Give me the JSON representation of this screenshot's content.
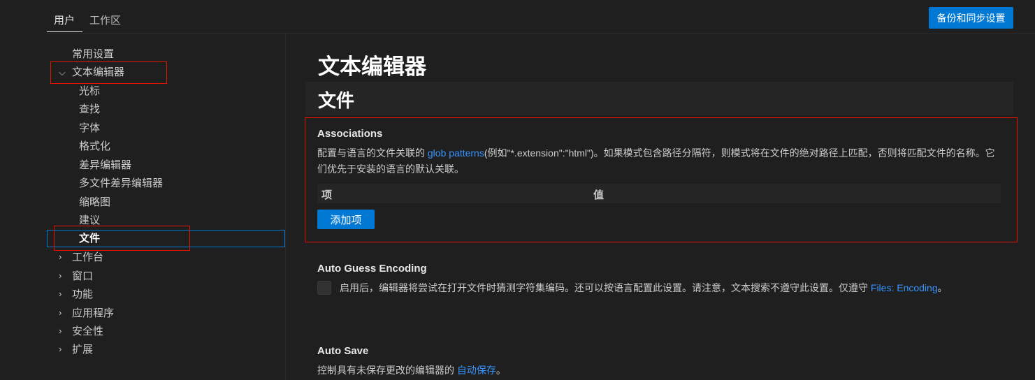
{
  "tabs": {
    "user": "用户",
    "workspace": "工作区"
  },
  "sync_button": "备份和同步设置",
  "sidebar": {
    "common": "常用设置",
    "text_editor": "文本编辑器",
    "children": [
      "光标",
      "查找",
      "字体",
      "格式化",
      "差异编辑器",
      "多文件差异编辑器",
      "缩略图",
      "建议",
      "文件"
    ],
    "groups": [
      "工作台",
      "窗口",
      "功能",
      "应用程序",
      "安全性",
      "扩展"
    ]
  },
  "main": {
    "title": "文本编辑器",
    "section": "文件",
    "associations": {
      "title": "Associations",
      "desc_pre": "配置与语言的文件关联的 ",
      "link": "glob patterns",
      "desc_post": "(例如\"*.extension\":\"html\")。如果模式包含路径分隔符，则模式将在文件的绝对路径上匹配，否则将匹配文件的名称。它们优先于安装的语言的默认关联。",
      "col_item": "项",
      "col_value": "值",
      "add_button": "添加项"
    },
    "auto_guess": {
      "title": "Auto Guess Encoding",
      "desc": "启用后，编辑器将尝试在打开文件时猜测字符集编码。还可以按语言配置此设置。请注意，文本搜索不遵守此设置。仅遵守 ",
      "link": "Files: Encoding",
      "desc_end": "。",
      "checked": false
    },
    "auto_save": {
      "title": "Auto Save",
      "desc": "控制具有未保存更改的编辑器的 ",
      "link": "自动保存",
      "desc_end": "。"
    }
  }
}
